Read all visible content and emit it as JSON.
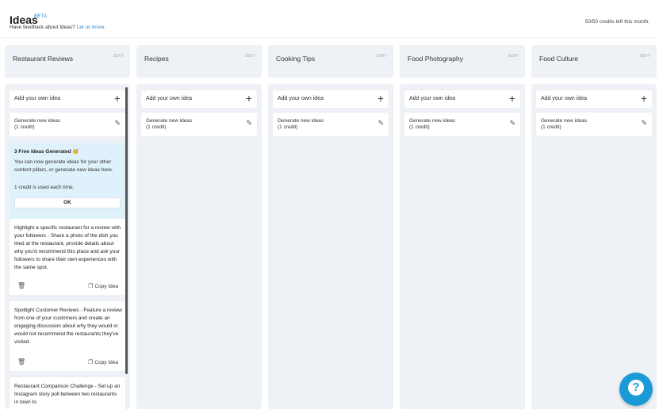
{
  "header": {
    "title": "Ideas",
    "beta": "BETA",
    "feedback_text": "Have feedback about Ideas?",
    "feedback_link": "Let us know.",
    "credits": "50/50 credits left this month."
  },
  "common": {
    "edit_label": "EDIT",
    "add_label": "Add your own idea",
    "generate_line1": "Generate new ideas",
    "generate_line2": "(1 credit)"
  },
  "columns": [
    {
      "name": "Restaurant Reviews"
    },
    {
      "name": "Recipes"
    },
    {
      "name": "Cooking Tips"
    },
    {
      "name": "Food Photography"
    },
    {
      "name": "Food Culture"
    }
  ],
  "notice": {
    "title": "3 Free Ideas Generated 🥳",
    "body": "You can now generate ideas for your other content pillars, or generate new ideas here.",
    "credit_note": "1 credit is used each time.",
    "ok_label": "OK"
  },
  "ideas": [
    {
      "text": "Highlight a specific restaurant for a review with your followers - Share a photo of the dish you tried at the restaurant, provide details about why you'd recommend this place and ask your followers to share their own experiences with the same spot.",
      "copy_label": "Copy Idea"
    },
    {
      "text": "Spotlight Customer Reviews - Feature a review from one of your customers and create an engaging discussion about why they would or would not recommend the restaurants they've visited.",
      "copy_label": "Copy Idea"
    },
    {
      "text": "Restaurant Comparison Challenge - Set up an Instagram story poll between two restaurants in town to",
      "copy_label": ""
    }
  ],
  "colors": {
    "accent": "#1a9ad6",
    "column_bg": "#eef1f5",
    "notice_bg": "#dff2fb",
    "link": "#2a86c9"
  },
  "icons": [
    "plus-icon",
    "pencil-icon",
    "trash-icon",
    "copy-icon",
    "help-icon"
  ]
}
